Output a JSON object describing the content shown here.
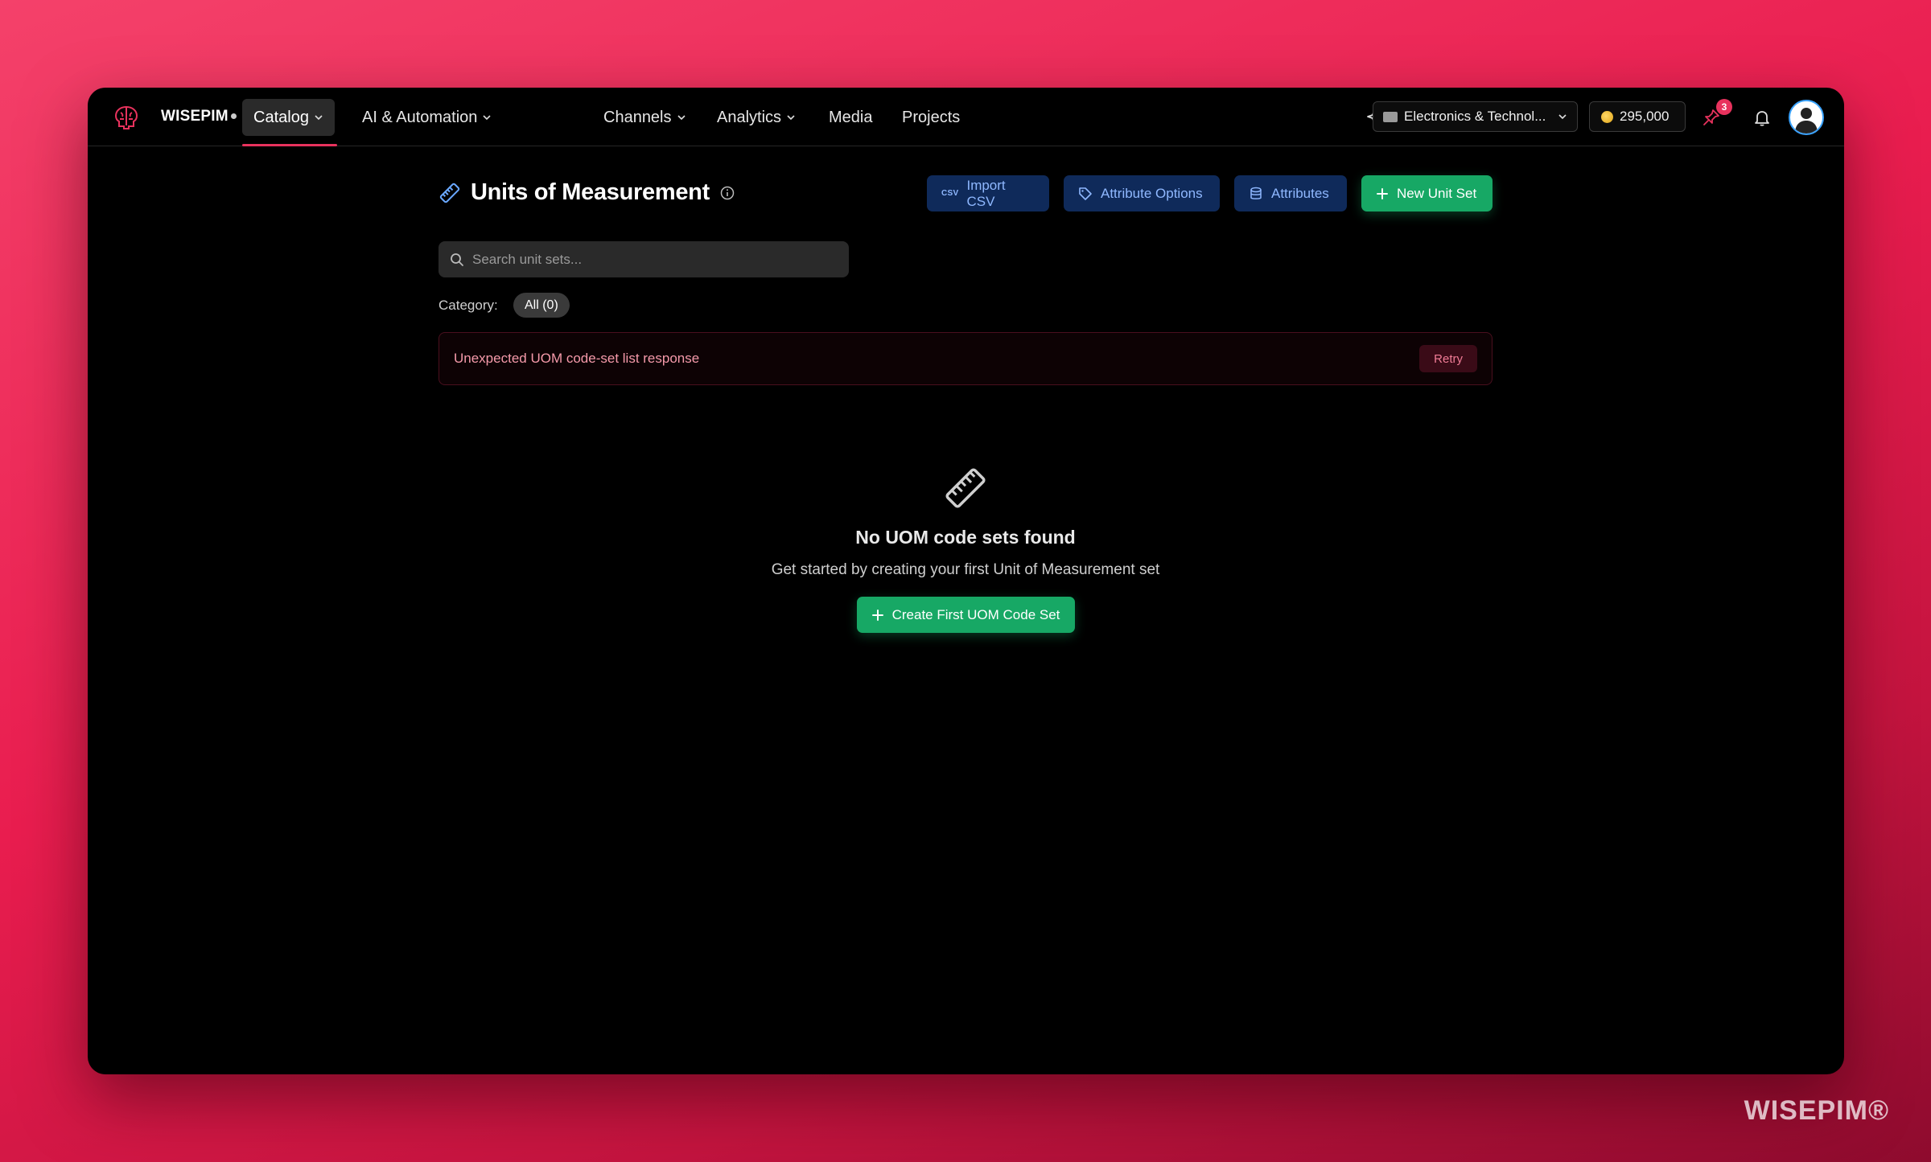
{
  "brand": {
    "name": "WISEPIM"
  },
  "nav": {
    "items": [
      {
        "label": "Catalog",
        "has_menu": true,
        "active": true
      },
      {
        "label": "AI & Automation",
        "has_menu": true
      },
      {
        "label": "Channels",
        "has_menu": true
      },
      {
        "label": "Analytics",
        "has_menu": true
      },
      {
        "label": "Media"
      },
      {
        "label": "Projects"
      }
    ]
  },
  "header": {
    "workspace": "Electronics & Technol...",
    "credits": "295,000",
    "notifications_badge": "3"
  },
  "page": {
    "title": "Units of Measurement",
    "actions": {
      "import_csv": "Import CSV",
      "csv_tag": "CSV",
      "attribute_options": "Attribute Options",
      "attributes": "Attributes",
      "new_unit_set": "New Unit Set"
    },
    "search_placeholder": "Search unit sets...",
    "category_label": "Category:",
    "category_chip": "All (0)",
    "error": {
      "message": "Unexpected UOM code-set list response",
      "retry": "Retry"
    },
    "empty": {
      "title": "No UOM code sets found",
      "subtitle": "Get started by creating your first Unit of Measurement set",
      "cta": "Create First UOM Code Set"
    }
  },
  "watermark": "WISEPIM®",
  "colors": {
    "accent": "#e8325d",
    "green": "#17a865",
    "blue_btn": "#0f2a5a",
    "blue_text": "#8fb8ff"
  }
}
